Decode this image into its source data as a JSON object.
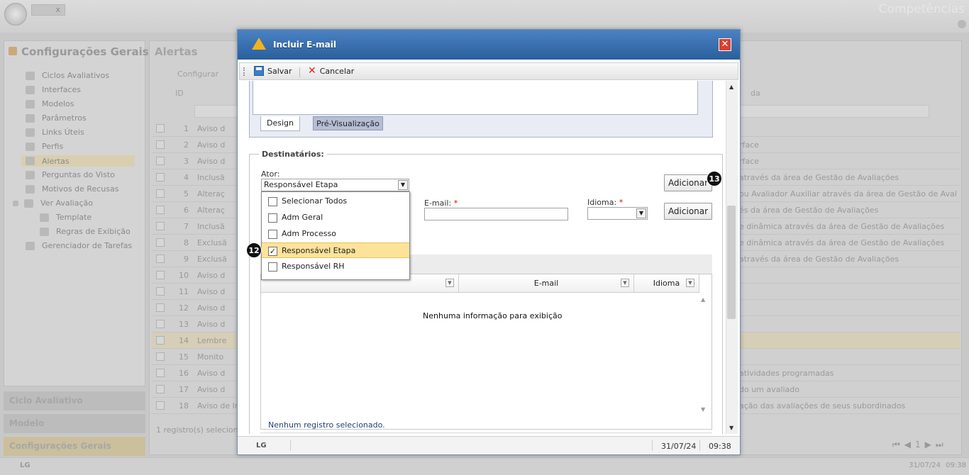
{
  "app": {
    "title": "Competências",
    "tab_close": "x"
  },
  "left_panel": {
    "title": "Configurações Gerais",
    "items": [
      {
        "label": "Ciclos Avaliativos"
      },
      {
        "label": "Interfaces"
      },
      {
        "label": "Modelos"
      },
      {
        "label": "Parâmetros"
      },
      {
        "label": "Links Úteis"
      },
      {
        "label": "Perfis"
      },
      {
        "label": "Alertas"
      },
      {
        "label": "Perguntas do Visto"
      },
      {
        "label": "Motivos de Recusas"
      },
      {
        "label": "Ver Avaliação"
      },
      {
        "label": "Template"
      },
      {
        "label": "Regras de Exibição"
      },
      {
        "label": "Gerenciador de Tarefas"
      }
    ],
    "accordion": [
      "Ciclo Avaliativo",
      "Modelo",
      "Configurações Gerais"
    ]
  },
  "main_panel": {
    "title": "Alertas",
    "configure_label": "Configurar",
    "id_header": "ID",
    "right_header": "da",
    "rows": [
      {
        "num": "1",
        "text": "Aviso d",
        "right": ""
      },
      {
        "num": "2",
        "text": "Aviso d",
        "right": "rface"
      },
      {
        "num": "3",
        "text": "Aviso d",
        "right": "rface"
      },
      {
        "num": "4",
        "text": "Inclusã",
        "right": "através da área de Gestão de Avaliações"
      },
      {
        "num": "5",
        "text": "Alteraç",
        "right": "ou Avaliador Auxiliar através da área de Gestão de Avaliaçõ"
      },
      {
        "num": "6",
        "text": "Alteraç",
        "right": "és da área de Gestão de Avaliações"
      },
      {
        "num": "7",
        "text": "Inclusã",
        "right": "e dinâmica através da área de Gestão de Avaliações"
      },
      {
        "num": "8",
        "text": "Exclusã",
        "right": "e dinâmica através da área de Gestão de Avaliações"
      },
      {
        "num": "9",
        "text": "Exclusã",
        "right": "através da área de Gestão de Avaliações"
      },
      {
        "num": "10",
        "text": "Aviso d",
        "right": ""
      },
      {
        "num": "11",
        "text": "Aviso d",
        "right": ""
      },
      {
        "num": "12",
        "text": "Aviso d",
        "right": ""
      },
      {
        "num": "13",
        "text": "Aviso d",
        "right": ""
      },
      {
        "num": "14",
        "text": "Lembre",
        "right": ""
      },
      {
        "num": "15",
        "text": "Monito",
        "right": ""
      },
      {
        "num": "16",
        "text": "Aviso d",
        "right": "atividades programadas"
      },
      {
        "num": "17",
        "text": "Aviso d",
        "right": "do um avaliado"
      },
      {
        "num": "18",
        "text": "Aviso de Inic",
        "right": "ação das avaliações de seus subordinados"
      }
    ],
    "count_text": "1 registro(s) selecionad",
    "page_number": "1"
  },
  "footer": {
    "logo": "LG",
    "date": "31/07/24",
    "time": "09:38"
  },
  "modal": {
    "title": "Incluir E-mail",
    "close": "✕",
    "toolbar": {
      "save_label": "Salvar",
      "cancel_label": "Cancelar"
    },
    "tabs": {
      "design": "Design",
      "preview": "Pré-Visualização"
    },
    "recipients": {
      "legend": "Destinatários:",
      "actor_label": "Ator:",
      "actor_value": "Responsável Etapa",
      "email_label": "E-mail:",
      "email_value": "",
      "language_label": "Idioma:",
      "language_value": "",
      "required_mark": "*",
      "add_button_1": "Adicionar",
      "add_button_2": "Adicionar",
      "actor_options": [
        {
          "label": "Selecionar Todos",
          "checked": false
        },
        {
          "label": "Adm Geral",
          "checked": false
        },
        {
          "label": "Adm Processo",
          "checked": false
        },
        {
          "label": "Responsável Etapa",
          "checked": true
        },
        {
          "label": "Responsável RH",
          "checked": false
        }
      ],
      "grid": {
        "headers": [
          "",
          "E-mail",
          "Idioma"
        ],
        "empty_text": "Nenhuma informação para exibição",
        "selection_text": "Nenhum registro selecionado."
      }
    },
    "footer": {
      "logo": "LG",
      "date": "31/07/24",
      "time": "09:38"
    }
  },
  "badges": {
    "step_12": "12",
    "step_13": "13"
  }
}
